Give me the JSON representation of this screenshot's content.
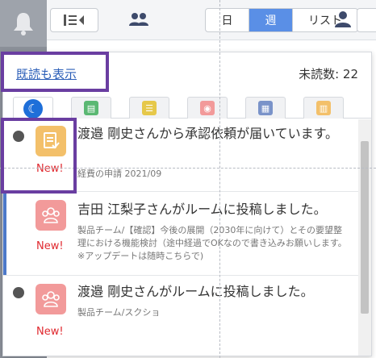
{
  "toolbar": {
    "view_day": "日",
    "view_week": "週",
    "view_list": "リスト"
  },
  "panel": {
    "show_read_link": "既読も表示",
    "unread_label": "未読数: 22"
  },
  "tabs": [
    {
      "name": "all",
      "color": "#1e6fd9"
    },
    {
      "name": "report",
      "color": "#5bb873"
    },
    {
      "name": "todo",
      "color": "#e6c84a"
    },
    {
      "name": "room",
      "color": "#f29a9a"
    },
    {
      "name": "schedule",
      "color": "#7a93c9"
    },
    {
      "name": "approval",
      "color": "#f3c06a"
    }
  ],
  "notifications": [
    {
      "title": "渡邉 剛史さんから承認依頼が届いています。",
      "subtitle": "経費の申請 2021/09",
      "badge": "New!",
      "icon": "approval-icon"
    },
    {
      "title": "吉田 江梨子さんがルームに投稿しました。",
      "subtitle": "製品チーム/【確認】今後の展開（2030年に向けて）とその要望整理における機能検討（途中経過でOKなので書き込みお願いします。※アップデートは随時こちらで)",
      "badge": "New!",
      "icon": "room-icon"
    },
    {
      "title": "渡邉 剛史さんがルームに投稿しました。",
      "subtitle": "製品チーム/スクショ",
      "badge": "New!",
      "icon": "room-icon"
    }
  ]
}
